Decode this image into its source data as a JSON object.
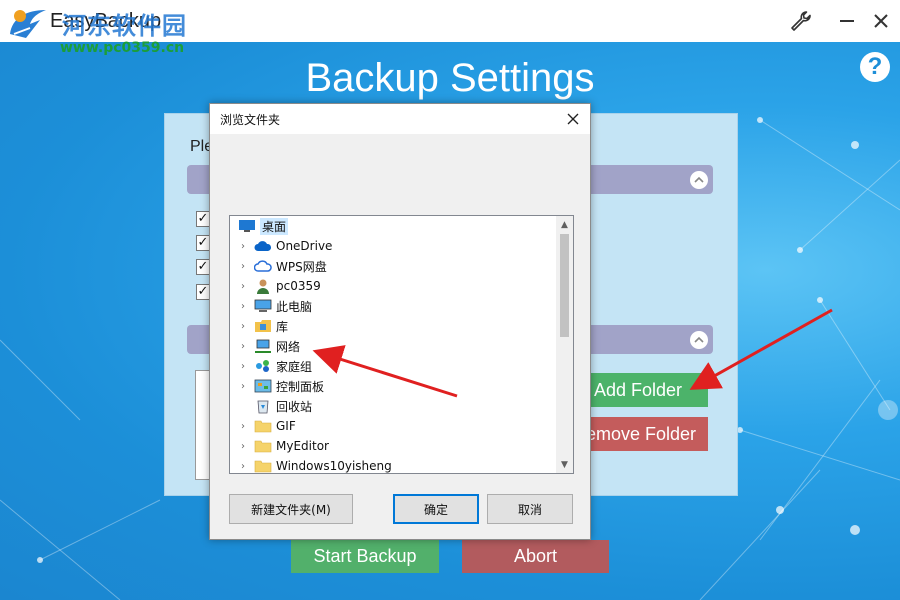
{
  "app": {
    "title": "EasyBackup",
    "watermark_name": "河东软件园",
    "watermark_url": "www.pc0359.cn"
  },
  "header": {
    "page_title": "Backup Settings",
    "help_label": "?"
  },
  "panel": {
    "prompt_label": "Ple",
    "checkbox_mark": "✓",
    "add_folder": "Add Folder",
    "remove_folder": "emove Folder",
    "start_backup": "Start Backup",
    "abort": "Abort"
  },
  "dialog": {
    "title": "浏览文件夹",
    "tree": [
      {
        "label": "桌面",
        "icon": "desktop-icon",
        "expandable": false,
        "selected": true,
        "indent": 0
      },
      {
        "label": "OneDrive",
        "icon": "onedrive-cloud-icon",
        "expandable": true,
        "indent": 1
      },
      {
        "label": "WPS网盘",
        "icon": "wps-cloud-icon",
        "expandable": true,
        "indent": 1
      },
      {
        "label": "pc0359",
        "icon": "user-icon",
        "expandable": true,
        "indent": 1
      },
      {
        "label": "此电脑",
        "icon": "computer-icon",
        "expandable": true,
        "indent": 1
      },
      {
        "label": "库",
        "icon": "library-icon",
        "expandable": true,
        "indent": 1
      },
      {
        "label": "网络",
        "icon": "network-icon",
        "expandable": true,
        "indent": 1
      },
      {
        "label": "家庭组",
        "icon": "homegroup-icon",
        "expandable": true,
        "indent": 1
      },
      {
        "label": "控制面板",
        "icon": "control-panel-icon",
        "expandable": true,
        "indent": 1
      },
      {
        "label": "回收站",
        "icon": "recycle-bin-icon",
        "expandable": false,
        "indent": 1
      },
      {
        "label": "GIF",
        "icon": "folder-icon",
        "expandable": true,
        "indent": 1
      },
      {
        "label": "MyEditor",
        "icon": "folder-icon",
        "expandable": true,
        "indent": 1
      },
      {
        "label": "Windows10yisheng",
        "icon": "folder-icon",
        "expandable": true,
        "indent": 1
      }
    ],
    "new_folder": "新建文件夹(M)",
    "ok": "确定",
    "cancel": "取消"
  },
  "colors": {
    "background": "#1e8fd8",
    "add_button": "#4cb36a",
    "remove_button": "#c45c5c",
    "annotation_arrow": "#e02020"
  }
}
